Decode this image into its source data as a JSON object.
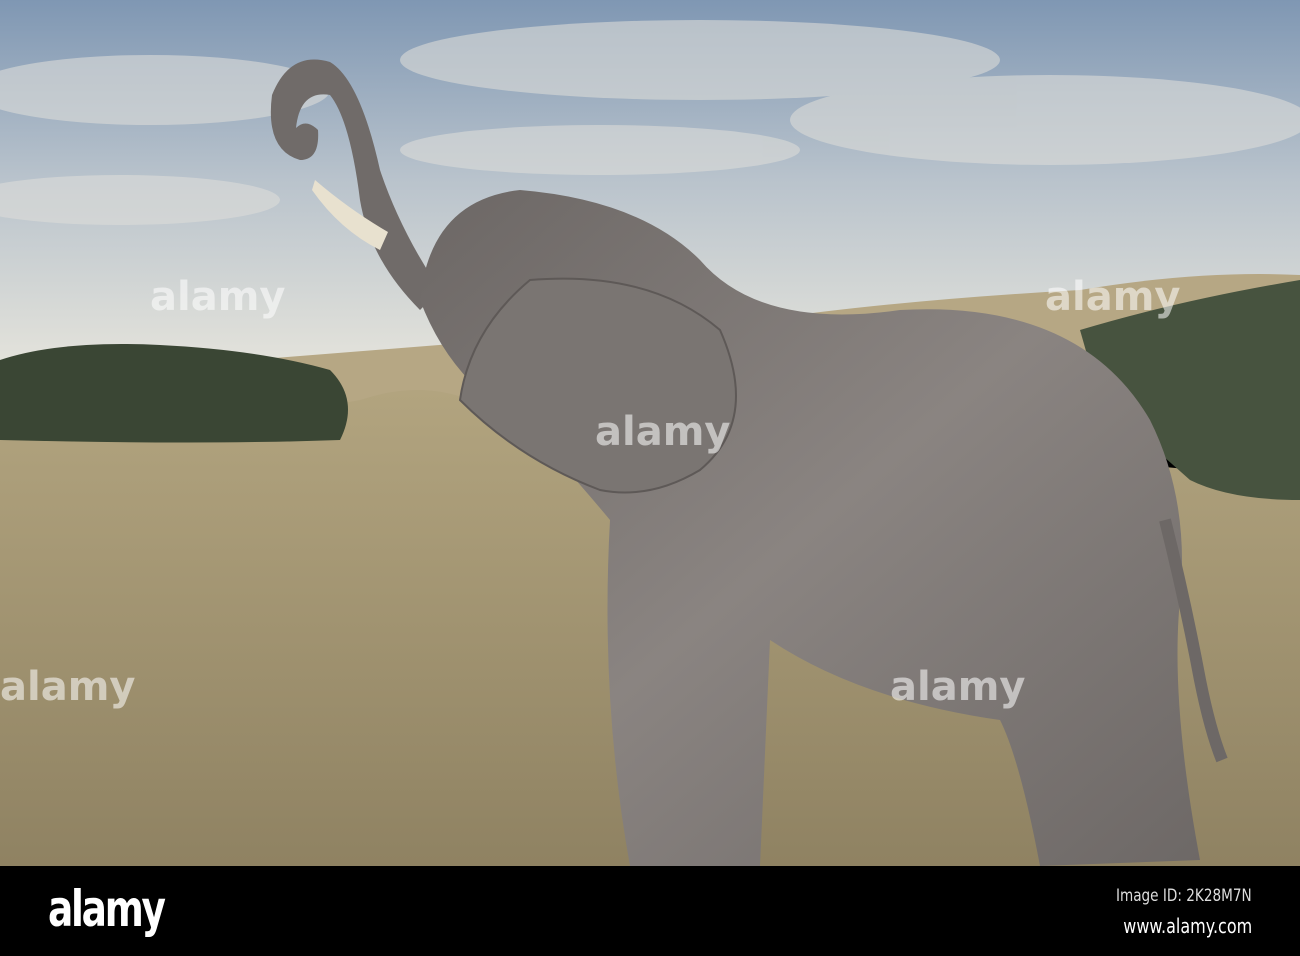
{
  "photo": {
    "subject": "elephant-in-desert",
    "watermark": "alamy",
    "colors": {
      "sky_top": "#7f97b3",
      "sky_bottom": "#e8e6dc",
      "sand": "#a3956f",
      "bush": "#3a4634",
      "elephant": "#807a77"
    }
  },
  "footer": {
    "logo": "alamy",
    "image_id": "Image ID: 2K28M7N",
    "website": "www.alamy.com"
  }
}
